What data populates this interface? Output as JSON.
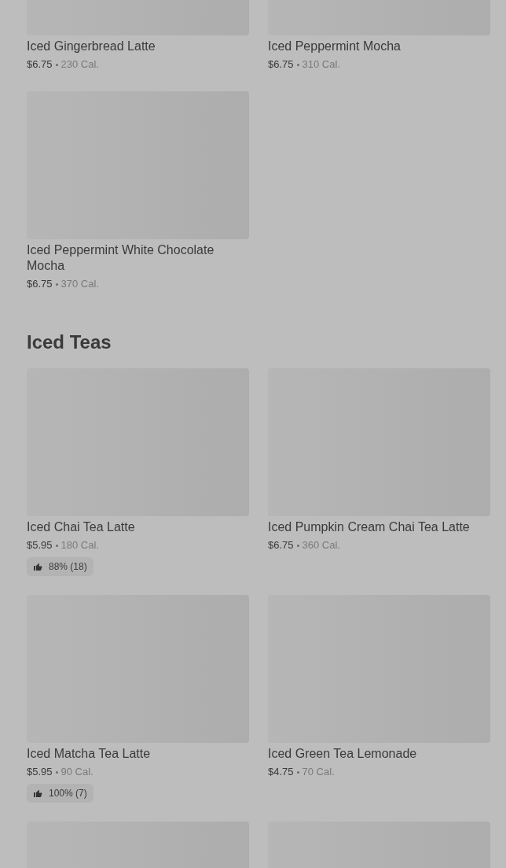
{
  "sections": [
    {
      "items": [
        {
          "kind": "item",
          "name": "Iced Gingerbread Latte",
          "price": "$6.75",
          "calories": "230 Cal."
        },
        {
          "kind": "item",
          "name": "Iced Peppermint Mocha",
          "price": "$6.75",
          "calories": "310 Cal."
        },
        {
          "kind": "item",
          "name": "Iced Peppermint White Chocolate Mocha",
          "price": "$6.75",
          "calories": "370 Cal."
        }
      ]
    },
    {
      "title": "Iced Teas",
      "items": [
        {
          "kind": "item",
          "name": "Iced Chai Tea Latte",
          "price": "$5.95",
          "calories": "180 Cal.",
          "rating": "88% (18)"
        },
        {
          "kind": "item",
          "name": "Iced Pumpkin Cream Chai Tea Latte",
          "price": "$6.75",
          "calories": "360 Cal."
        },
        {
          "kind": "item",
          "name": "Iced Matcha Tea Latte",
          "price": "$5.95",
          "calories": "90 Cal.",
          "rating": "100% (7)"
        },
        {
          "kind": "item",
          "name": "Iced Green Tea Lemonade",
          "price": "$4.75",
          "calories": "70 Cal."
        },
        {
          "kind": "image_only"
        },
        {
          "kind": "image_only"
        }
      ]
    }
  ]
}
